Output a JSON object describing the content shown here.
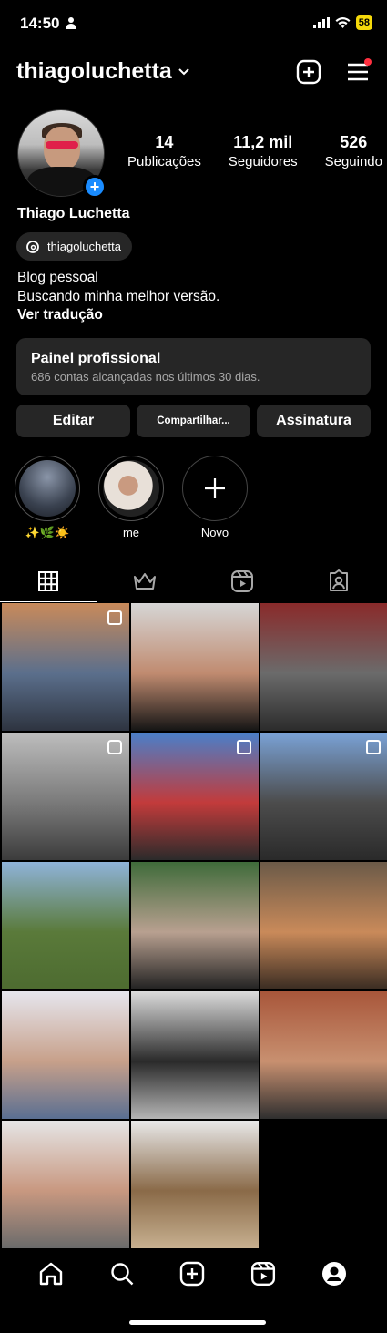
{
  "status_bar": {
    "time": "14:50",
    "battery": "58"
  },
  "header": {
    "username": "thiagoluchetta"
  },
  "profile": {
    "stats": [
      {
        "value": "14",
        "label": "Publicações"
      },
      {
        "value": "11,2 mil",
        "label": "Seguidores"
      },
      {
        "value": "526",
        "label": "Seguindo"
      }
    ],
    "full_name": "Thiago Luchetta",
    "threads_handle": "thiagoluchetta",
    "bio_line1": "Blog pessoal",
    "bio_line2": "Buscando minha melhor versão.",
    "translate_link": "Ver tradução"
  },
  "panel": {
    "title": "Painel profissional",
    "subtitle": "686 contas alcançadas nos últimos 30 dias."
  },
  "buttons": {
    "edit": "Editar",
    "share": "Compartilhar...",
    "subscription": "Assinatura"
  },
  "highlights": [
    {
      "label": "✨🌿☀️"
    },
    {
      "label": "me"
    },
    {
      "label": "Novo"
    }
  ],
  "grid_posts": [
    {
      "badge": "multi",
      "colors": [
        "#c98a5a",
        "#5b6f8c",
        "#2e3440"
      ]
    },
    {
      "badge": "none",
      "colors": [
        "#d6d6d6",
        "#c08b70",
        "#151515"
      ]
    },
    {
      "badge": "none",
      "colors": [
        "#8a2a2a",
        "#6b6b6b",
        "#2c2c2c"
      ]
    },
    {
      "badge": "reel",
      "colors": [
        "#bdbdbd",
        "#7a7a7a",
        "#3c3c3c"
      ]
    },
    {
      "badge": "multi",
      "colors": [
        "#4a7fc9",
        "#c23b3b",
        "#2b2b2b"
      ]
    },
    {
      "badge": "multi",
      "colors": [
        "#7aa2d6",
        "#4c4c4c",
        "#2a2a2a"
      ]
    },
    {
      "badge": "none",
      "colors": [
        "#8fb3d9",
        "#5a7a3a",
        "#4d6b30"
      ]
    },
    {
      "badge": "none",
      "colors": [
        "#3f6b3a",
        "#b8a090",
        "#222"
      ]
    },
    {
      "badge": "none",
      "colors": [
        "#6b5a48",
        "#c98a5a",
        "#3a2c22"
      ]
    },
    {
      "badge": "none",
      "colors": [
        "#e6e6ee",
        "#c7a08a",
        "#5a6f92"
      ]
    },
    {
      "badge": "none",
      "colors": [
        "#dcdcdc",
        "#2a2a2a",
        "#b5b5b5"
      ]
    },
    {
      "badge": "none",
      "colors": [
        "#a8563a",
        "#c89070",
        "#2f2f2f"
      ]
    },
    {
      "badge": "none",
      "colors": [
        "#e5e5e5",
        "#c89880",
        "#6b6b6b"
      ]
    },
    {
      "badge": "none",
      "colors": [
        "#e8e8e8",
        "#8a6a48",
        "#c7b090"
      ]
    }
  ],
  "accent": {
    "blue": "#1a8cff",
    "notification": "#ff3040",
    "battery": "#f5d90a"
  }
}
